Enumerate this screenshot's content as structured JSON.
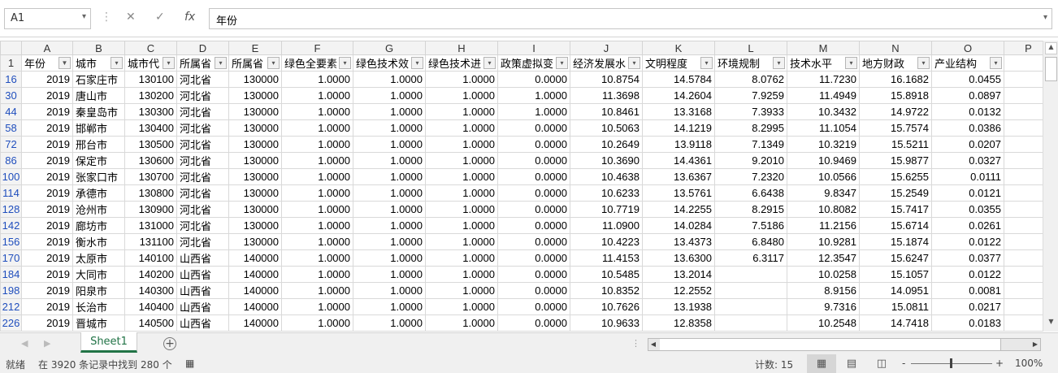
{
  "formula_bar": {
    "name_box": "A1",
    "cancel_icon": "✕",
    "enter_icon": "✓",
    "fx_label": "fx",
    "formula": "年份"
  },
  "columns": [
    "A",
    "B",
    "C",
    "D",
    "E",
    "F",
    "G",
    "H",
    "I",
    "J",
    "K",
    "L",
    "M",
    "N",
    "O",
    "P"
  ],
  "header_row": {
    "row_number": "1",
    "cells": [
      "年份",
      "城市",
      "城市代",
      "所属省",
      "所属省",
      "绿色全要素",
      "绿色技术效",
      "绿色技术进",
      "政策虚拟变",
      "经济发展水",
      "文明程度",
      "环境规制",
      "技术水平",
      "地方财政",
      "产业结构"
    ]
  },
  "rows": [
    {
      "n": "16",
      "c": [
        "2019",
        "石家庄市",
        "130100",
        "河北省",
        "130000",
        "1.0000",
        "1.0000",
        "1.0000",
        "0.0000",
        "10.8754",
        "14.5784",
        "8.0762",
        "11.7230",
        "16.1682",
        "0.0455"
      ]
    },
    {
      "n": "30",
      "c": [
        "2019",
        "唐山市",
        "130200",
        "河北省",
        "130000",
        "1.0000",
        "1.0000",
        "1.0000",
        "1.0000",
        "11.3698",
        "14.2604",
        "7.9259",
        "11.4949",
        "15.8918",
        "0.0897"
      ]
    },
    {
      "n": "44",
      "c": [
        "2019",
        "秦皇岛市",
        "130300",
        "河北省",
        "130000",
        "1.0000",
        "1.0000",
        "1.0000",
        "1.0000",
        "10.8461",
        "13.3168",
        "7.3933",
        "10.3432",
        "14.9722",
        "0.0132"
      ]
    },
    {
      "n": "58",
      "c": [
        "2019",
        "邯郸市",
        "130400",
        "河北省",
        "130000",
        "1.0000",
        "1.0000",
        "1.0000",
        "0.0000",
        "10.5063",
        "14.1219",
        "8.2995",
        "11.1054",
        "15.7574",
        "0.0386"
      ]
    },
    {
      "n": "72",
      "c": [
        "2019",
        "邢台市",
        "130500",
        "河北省",
        "130000",
        "1.0000",
        "1.0000",
        "1.0000",
        "0.0000",
        "10.2649",
        "13.9118",
        "7.1349",
        "10.3219",
        "15.5211",
        "0.0207"
      ]
    },
    {
      "n": "86",
      "c": [
        "2019",
        "保定市",
        "130600",
        "河北省",
        "130000",
        "1.0000",
        "1.0000",
        "1.0000",
        "0.0000",
        "10.3690",
        "14.4361",
        "9.2010",
        "10.9469",
        "15.9877",
        "0.0327"
      ]
    },
    {
      "n": "100",
      "c": [
        "2019",
        "张家口市",
        "130700",
        "河北省",
        "130000",
        "1.0000",
        "1.0000",
        "1.0000",
        "0.0000",
        "10.4638",
        "13.6367",
        "7.2320",
        "10.0566",
        "15.6255",
        "0.0111"
      ]
    },
    {
      "n": "114",
      "c": [
        "2019",
        "承德市",
        "130800",
        "河北省",
        "130000",
        "1.0000",
        "1.0000",
        "1.0000",
        "0.0000",
        "10.6233",
        "13.5761",
        "6.6438",
        "9.8347",
        "15.2549",
        "0.0121"
      ]
    },
    {
      "n": "128",
      "c": [
        "2019",
        "沧州市",
        "130900",
        "河北省",
        "130000",
        "1.0000",
        "1.0000",
        "1.0000",
        "0.0000",
        "10.7719",
        "14.2255",
        "8.2915",
        "10.8082",
        "15.7417",
        "0.0355"
      ]
    },
    {
      "n": "142",
      "c": [
        "2019",
        "廊坊市",
        "131000",
        "河北省",
        "130000",
        "1.0000",
        "1.0000",
        "1.0000",
        "0.0000",
        "11.0900",
        "14.0284",
        "7.5186",
        "11.2156",
        "15.6714",
        "0.0261"
      ]
    },
    {
      "n": "156",
      "c": [
        "2019",
        "衡水市",
        "131100",
        "河北省",
        "130000",
        "1.0000",
        "1.0000",
        "1.0000",
        "0.0000",
        "10.4223",
        "13.4373",
        "6.8480",
        "10.9281",
        "15.1874",
        "0.0122"
      ]
    },
    {
      "n": "170",
      "c": [
        "2019",
        "太原市",
        "140100",
        "山西省",
        "140000",
        "1.0000",
        "1.0000",
        "1.0000",
        "0.0000",
        "11.4153",
        "13.6300",
        "6.3117",
        "12.3547",
        "15.6247",
        "0.0377"
      ]
    },
    {
      "n": "184",
      "c": [
        "2019",
        "大同市",
        "140200",
        "山西省",
        "140000",
        "1.0000",
        "1.0000",
        "1.0000",
        "0.0000",
        "10.5485",
        "13.2014",
        "",
        "10.0258",
        "15.1057",
        "0.0122"
      ]
    },
    {
      "n": "198",
      "c": [
        "2019",
        "阳泉市",
        "140300",
        "山西省",
        "140000",
        "1.0000",
        "1.0000",
        "1.0000",
        "0.0000",
        "10.8352",
        "12.2552",
        "",
        "8.9156",
        "14.0951",
        "0.0081"
      ]
    },
    {
      "n": "212",
      "c": [
        "2019",
        "长治市",
        "140400",
        "山西省",
        "140000",
        "1.0000",
        "1.0000",
        "1.0000",
        "0.0000",
        "10.7626",
        "13.1938",
        "",
        "9.7316",
        "15.0811",
        "0.0217"
      ]
    },
    {
      "n": "226",
      "c": [
        "2019",
        "晋城市",
        "140500",
        "山西省",
        "140000",
        "1.0000",
        "1.0000",
        "1.0000",
        "0.0000",
        "10.9633",
        "12.8358",
        "",
        "10.2548",
        "14.7418",
        "0.0183"
      ]
    }
  ],
  "sheet_tabs": {
    "active": "Sheet1",
    "add": "+"
  },
  "status": {
    "ready": "就绪",
    "filter_info": "在 3920 条记录中找到 280 个",
    "count": "计数: 15",
    "zoom_minus": "-",
    "zoom_plus": "+",
    "zoom": "100%"
  },
  "colors": {
    "accent": "#217346",
    "filtered_row_number": "#1f4ebd"
  }
}
